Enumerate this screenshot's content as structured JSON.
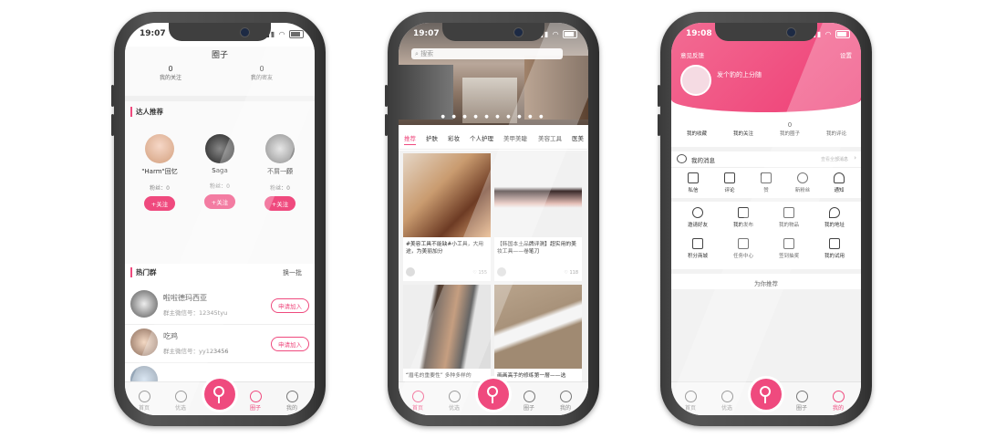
{
  "colors": {
    "accent": "#ef4a7e",
    "frame": "#444444"
  },
  "phone1": {
    "status_time": "19:07",
    "title": "圈子",
    "stats": [
      {
        "count": "0",
        "label": "我的关注"
      },
      {
        "count": "0",
        "label": "我的密友"
      }
    ],
    "recommend_title": "达人推荐",
    "experts": [
      {
        "name": "\"Harm\"回忆",
        "fans": "粉丝：0",
        "follow": "+关注"
      },
      {
        "name": "Saga",
        "fans": "粉丝：0",
        "follow": "+关注"
      },
      {
        "name": "不屑一顾",
        "fans": "粉丝：0",
        "follow": "+关注"
      }
    ],
    "hot_groups_title": "热门群",
    "refresh": "换一批",
    "groups": [
      {
        "name": "啦啦德玛西亚",
        "wechat": "群主微信号：12345tyu",
        "join": "申请加入"
      },
      {
        "name": "吃鸡",
        "wechat": "群主微信号：yy123456",
        "join": "申请加入"
      }
    ],
    "tabs": [
      "首页",
      "优选",
      "",
      "圈子",
      "我的"
    ]
  },
  "phone2": {
    "status_time": "19:07",
    "search_placeholder": "搜索",
    "categories": [
      "推荐",
      "护肤",
      "彩妆",
      "个人护理",
      "美甲美睫",
      "美容工具",
      "医美"
    ],
    "posts": [
      {
        "title": "#美容工具不能缺#小工具，大用途，为美丽加分",
        "likes": "155"
      },
      {
        "title": "【韩国本土品牌评测】超实用的美妆工具——卷笔刀",
        "likes": "118"
      },
      {
        "title": "“眉毛的重要性” 多种多样的",
        "likes": ""
      },
      {
        "title": "画画高手的修练第一層——选",
        "likes": ""
      }
    ],
    "tabs": [
      "首页",
      "优选",
      "",
      "圈子",
      "我的"
    ]
  },
  "phone3": {
    "status_time": "19:08",
    "feedback": "意见反馈",
    "settings": "设置",
    "bio": "发个豹的上分随",
    "stats": [
      {
        "count": "",
        "label": "我的收藏"
      },
      {
        "count": "",
        "label": "我的关注"
      },
      {
        "count": "0",
        "label": "我的圈子"
      },
      {
        "count": "",
        "label": "我的评论"
      }
    ],
    "messages_title": "我的消息",
    "messages_hint": "查看全部消息",
    "grid_row1": [
      "私信",
      "评论",
      "赞",
      "新粉丝",
      "通知"
    ],
    "grid_row2": [
      "邀请好友",
      "我的发布",
      "我的物品",
      "我的地址"
    ],
    "grid_row3": [
      "积分商城",
      "任务中心",
      "签到抽奖",
      "我的试用"
    ],
    "recommend": "为你推荐",
    "tabs": [
      "首页",
      "优选",
      "",
      "圈子",
      "我的"
    ]
  }
}
